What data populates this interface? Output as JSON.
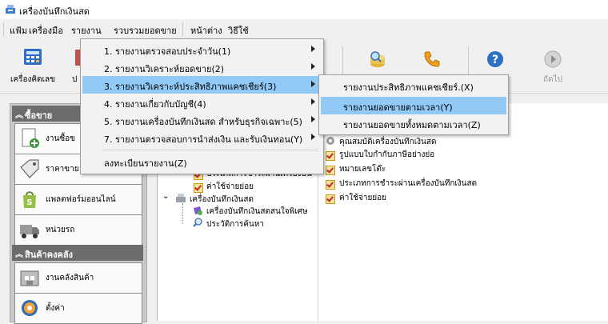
{
  "window": {
    "title": "เครื่องบันทึกเงินสด",
    "icon": "cash-register-icon"
  },
  "menubar": {
    "items": [
      "แฟ้ม",
      "เครื่องมือ",
      "รายงาน",
      "รวบรวมยอดขาย",
      "หน้าต่าง",
      "วิธีใช้"
    ]
  },
  "toolbar": {
    "calculator_label": "เครื่องคิดเลข",
    "partial_label": "ป",
    "next_label": "ถัดไป"
  },
  "sidebar": {
    "group1": "ซื้อขาย",
    "group1_items": [
      "งานซื้อข",
      "ราคาขาย",
      "แพลตฟอร์มออนไลน์",
      "หน่วยรถ"
    ],
    "group2": "สินค้าคงคลัง",
    "group2_items": [
      "งานคลังสินค้า",
      "ตั้งค่า"
    ]
  },
  "report_menu": {
    "items": [
      "1. รายงานตรวจสอบประจำวัน(1)",
      "2. รายงานวิเคราะห์ยอดขาย(2)",
      "3. รายงานวิเคราะห์ประสิทธิภาพแคชเชียร์(3)",
      "4. รายงานเกี่ยวกับบัญชี(4)",
      "5. รายงานเครื่องบันทึกเงินสด สำหรับธุรกิจเฉพาะ(5)",
      "7. รายงานตรวจสอบการนำส่งเงิน และรับเงินทอน(Y)"
    ],
    "register_label": "ลงทะเบียนรายงาน(Z)"
  },
  "submenu": {
    "items": [
      "รายงานประสิทธิภาพแคชเชียร์.(X)",
      "รายงานยอดขายตามเวลา(Y)",
      "รายงานยอดขายทั้งหมดตามเวลา(Z)"
    ]
  },
  "tree": {
    "row1": "ประเภทการชำระผ่านเครื่องบัน",
    "row2": "ค่าใช้จ่ายย่อย",
    "root": "เครื่องบันทึกเงินสด",
    "child1": "เครื่องบันทึกเงินสดสนใจพิเศษ",
    "child2": "ประวัติการค้นหา"
  },
  "checklist": {
    "items": [
      "คุณสมบัติเครื่องบันทึกเงินสด",
      "รูปแบบใบกำกับภาษีอย่างย่อ",
      "หมายเลขโต๊ะ",
      "ประเภทการชำระผ่านเครื่องบันทึกเงินสด",
      "ค่าใช้จ่ายย่อย"
    ]
  }
}
